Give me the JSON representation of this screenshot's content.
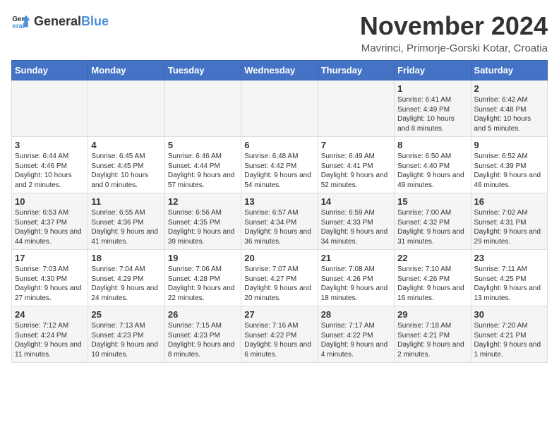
{
  "logo": {
    "general": "General",
    "blue": "Blue"
  },
  "header": {
    "month": "November 2024",
    "location": "Mavrinci, Primorje-Gorski Kotar, Croatia"
  },
  "weekdays": [
    "Sunday",
    "Monday",
    "Tuesday",
    "Wednesday",
    "Thursday",
    "Friday",
    "Saturday"
  ],
  "weeks": [
    [
      {
        "day": "",
        "sunrise": "",
        "sunset": "",
        "daylight": ""
      },
      {
        "day": "",
        "sunrise": "",
        "sunset": "",
        "daylight": ""
      },
      {
        "day": "",
        "sunrise": "",
        "sunset": "",
        "daylight": ""
      },
      {
        "day": "",
        "sunrise": "",
        "sunset": "",
        "daylight": ""
      },
      {
        "day": "",
        "sunrise": "",
        "sunset": "",
        "daylight": ""
      },
      {
        "day": "1",
        "sunrise": "Sunrise: 6:41 AM",
        "sunset": "Sunset: 4:49 PM",
        "daylight": "Daylight: 10 hours and 8 minutes."
      },
      {
        "day": "2",
        "sunrise": "Sunrise: 6:42 AM",
        "sunset": "Sunset: 4:48 PM",
        "daylight": "Daylight: 10 hours and 5 minutes."
      }
    ],
    [
      {
        "day": "3",
        "sunrise": "Sunrise: 6:44 AM",
        "sunset": "Sunset: 4:46 PM",
        "daylight": "Daylight: 10 hours and 2 minutes."
      },
      {
        "day": "4",
        "sunrise": "Sunrise: 6:45 AM",
        "sunset": "Sunset: 4:45 PM",
        "daylight": "Daylight: 10 hours and 0 minutes."
      },
      {
        "day": "5",
        "sunrise": "Sunrise: 6:46 AM",
        "sunset": "Sunset: 4:44 PM",
        "daylight": "Daylight: 9 hours and 57 minutes."
      },
      {
        "day": "6",
        "sunrise": "Sunrise: 6:48 AM",
        "sunset": "Sunset: 4:42 PM",
        "daylight": "Daylight: 9 hours and 54 minutes."
      },
      {
        "day": "7",
        "sunrise": "Sunrise: 6:49 AM",
        "sunset": "Sunset: 4:41 PM",
        "daylight": "Daylight: 9 hours and 52 minutes."
      },
      {
        "day": "8",
        "sunrise": "Sunrise: 6:50 AM",
        "sunset": "Sunset: 4:40 PM",
        "daylight": "Daylight: 9 hours and 49 minutes."
      },
      {
        "day": "9",
        "sunrise": "Sunrise: 6:52 AM",
        "sunset": "Sunset: 4:39 PM",
        "daylight": "Daylight: 9 hours and 46 minutes."
      }
    ],
    [
      {
        "day": "10",
        "sunrise": "Sunrise: 6:53 AM",
        "sunset": "Sunset: 4:37 PM",
        "daylight": "Daylight: 9 hours and 44 minutes."
      },
      {
        "day": "11",
        "sunrise": "Sunrise: 6:55 AM",
        "sunset": "Sunset: 4:36 PM",
        "daylight": "Daylight: 9 hours and 41 minutes."
      },
      {
        "day": "12",
        "sunrise": "Sunrise: 6:56 AM",
        "sunset": "Sunset: 4:35 PM",
        "daylight": "Daylight: 9 hours and 39 minutes."
      },
      {
        "day": "13",
        "sunrise": "Sunrise: 6:57 AM",
        "sunset": "Sunset: 4:34 PM",
        "daylight": "Daylight: 9 hours and 36 minutes."
      },
      {
        "day": "14",
        "sunrise": "Sunrise: 6:59 AM",
        "sunset": "Sunset: 4:33 PM",
        "daylight": "Daylight: 9 hours and 34 minutes."
      },
      {
        "day": "15",
        "sunrise": "Sunrise: 7:00 AM",
        "sunset": "Sunset: 4:32 PM",
        "daylight": "Daylight: 9 hours and 31 minutes."
      },
      {
        "day": "16",
        "sunrise": "Sunrise: 7:02 AM",
        "sunset": "Sunset: 4:31 PM",
        "daylight": "Daylight: 9 hours and 29 minutes."
      }
    ],
    [
      {
        "day": "17",
        "sunrise": "Sunrise: 7:03 AM",
        "sunset": "Sunset: 4:30 PM",
        "daylight": "Daylight: 9 hours and 27 minutes."
      },
      {
        "day": "18",
        "sunrise": "Sunrise: 7:04 AM",
        "sunset": "Sunset: 4:29 PM",
        "daylight": "Daylight: 9 hours and 24 minutes."
      },
      {
        "day": "19",
        "sunrise": "Sunrise: 7:06 AM",
        "sunset": "Sunset: 4:28 PM",
        "daylight": "Daylight: 9 hours and 22 minutes."
      },
      {
        "day": "20",
        "sunrise": "Sunrise: 7:07 AM",
        "sunset": "Sunset: 4:27 PM",
        "daylight": "Daylight: 9 hours and 20 minutes."
      },
      {
        "day": "21",
        "sunrise": "Sunrise: 7:08 AM",
        "sunset": "Sunset: 4:26 PM",
        "daylight": "Daylight: 9 hours and 18 minutes."
      },
      {
        "day": "22",
        "sunrise": "Sunrise: 7:10 AM",
        "sunset": "Sunset: 4:26 PM",
        "daylight": "Daylight: 9 hours and 16 minutes."
      },
      {
        "day": "23",
        "sunrise": "Sunrise: 7:11 AM",
        "sunset": "Sunset: 4:25 PM",
        "daylight": "Daylight: 9 hours and 13 minutes."
      }
    ],
    [
      {
        "day": "24",
        "sunrise": "Sunrise: 7:12 AM",
        "sunset": "Sunset: 4:24 PM",
        "daylight": "Daylight: 9 hours and 11 minutes."
      },
      {
        "day": "25",
        "sunrise": "Sunrise: 7:13 AM",
        "sunset": "Sunset: 4:23 PM",
        "daylight": "Daylight: 9 hours and 10 minutes."
      },
      {
        "day": "26",
        "sunrise": "Sunrise: 7:15 AM",
        "sunset": "Sunset: 4:23 PM",
        "daylight": "Daylight: 9 hours and 8 minutes."
      },
      {
        "day": "27",
        "sunrise": "Sunrise: 7:16 AM",
        "sunset": "Sunset: 4:22 PM",
        "daylight": "Daylight: 9 hours and 6 minutes."
      },
      {
        "day": "28",
        "sunrise": "Sunrise: 7:17 AM",
        "sunset": "Sunset: 4:22 PM",
        "daylight": "Daylight: 9 hours and 4 minutes."
      },
      {
        "day": "29",
        "sunrise": "Sunrise: 7:18 AM",
        "sunset": "Sunset: 4:21 PM",
        "daylight": "Daylight: 9 hours and 2 minutes."
      },
      {
        "day": "30",
        "sunrise": "Sunrise: 7:20 AM",
        "sunset": "Sunset: 4:21 PM",
        "daylight": "Daylight: 9 hours and 1 minute."
      }
    ]
  ]
}
